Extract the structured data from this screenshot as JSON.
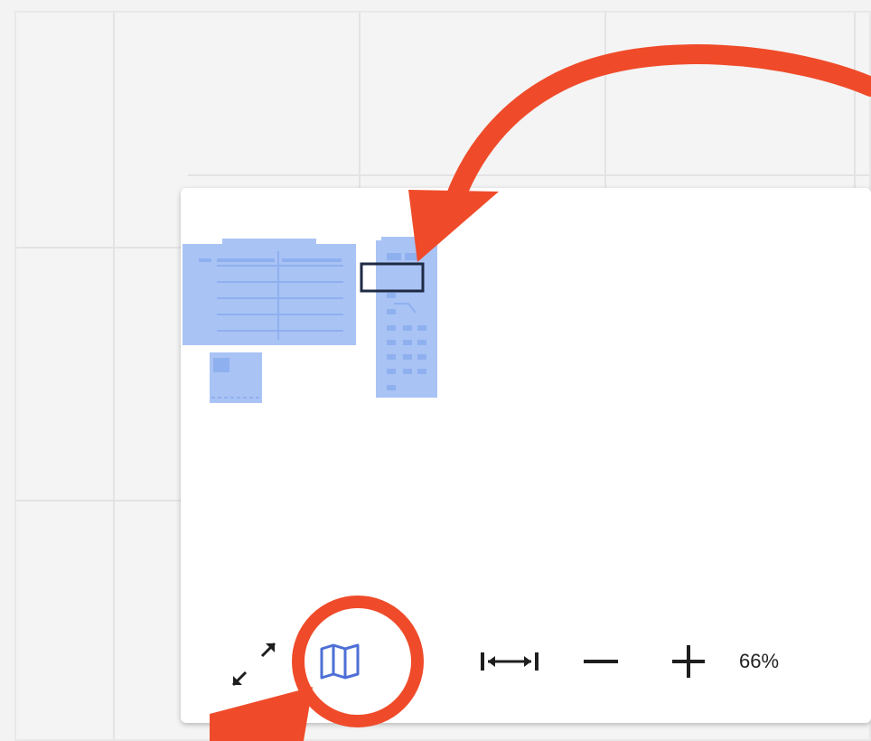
{
  "colors": {
    "page_background": "#f3f3f3",
    "grid_line": "#e3e3e3",
    "panel_background": "#ffffff",
    "preview_fill": "#a9c3f5",
    "preview_stroke": "#8fb0ef",
    "viewport_frame": "#1f2a44",
    "icon_blue": "#4d6fd6",
    "icon_dark": "#1e1e1e",
    "annotation_red": "#ef4b2a"
  },
  "toolbar": {
    "collapse_icon": "collapse-arrows-icon",
    "minimap_icon": "map-icon",
    "fit_width_icon": "fit-width-icon",
    "zoom_out_icon": "minus-icon",
    "zoom_in_icon": "plus-icon",
    "zoom_level": "66%"
  },
  "annotations": {
    "arrow_to_viewport": "curved-arrow",
    "circle_on_map_button": "highlight-circle",
    "arrow_to_map_button": "arrow"
  }
}
